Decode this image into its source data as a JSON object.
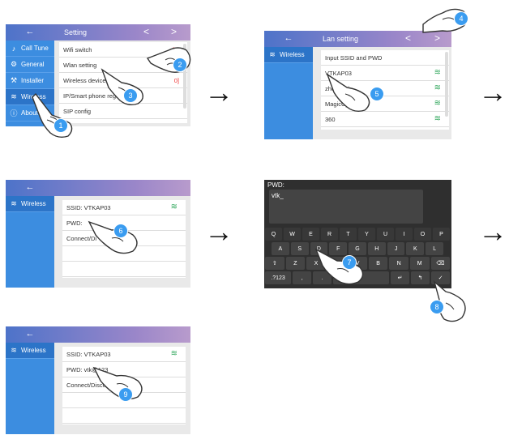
{
  "step1": {
    "header_back": "←",
    "header_title": "Setting",
    "header_prev": "<",
    "header_next": ">",
    "sidebar": [
      "Call Tune",
      "General",
      "Installer",
      "Wireless",
      "About"
    ],
    "rows": [
      {
        "label": "Wifi switch",
        "value": "[O"
      },
      {
        "label": "Wlan setting",
        "value": ""
      },
      {
        "label": "Wireless devices",
        "value": "0]"
      },
      {
        "label": "IP/Smart phone regi",
        "value": ""
      },
      {
        "label": "SIP config",
        "value": ""
      }
    ]
  },
  "step2": {
    "header_back": "←",
    "header_title": "Lan setting",
    "header_prev": "<",
    "header_next": ">",
    "sidebar": [
      "Wireless"
    ],
    "rows": [
      "Input SSID and PWD",
      "VTKAP03",
      "zhongshi",
      "MagicCyclingG",
      "360"
    ]
  },
  "step3": {
    "header_back": "←",
    "sidebar": [
      "Wireless"
    ],
    "rows": [
      "SSID: VTKAP03",
      "PWD:",
      "Connect/Di"
    ]
  },
  "step4": {
    "pwd_label": "PWD:",
    "pwd_value": "vtk_",
    "row1": [
      "Q",
      "W",
      "E",
      "R",
      "T",
      "Y",
      "U",
      "I",
      "O",
      "P"
    ],
    "row2": [
      "A",
      "S",
      "D",
      "F",
      "G",
      "H",
      "J",
      "K",
      "L"
    ],
    "row3": [
      "⇧",
      "Z",
      "X",
      "C",
      "V",
      "B",
      "N",
      "M",
      "⌫"
    ],
    "row4": [
      ".?123",
      ",",
      ".",
      "",
      "↵",
      "↰",
      "✓"
    ]
  },
  "step5": {
    "header_back": "←",
    "sidebar": [
      "Wireless"
    ],
    "rows": [
      "SSID: VTKAP03",
      "PWD: vtk@123",
      "Connect/Disconnect"
    ]
  },
  "badges": [
    "1",
    "2",
    "3",
    "4",
    "5",
    "6",
    "7",
    "8",
    "9"
  ],
  "arrows": [
    "→",
    "→",
    "→",
    "→"
  ],
  "icons": {
    "wifi": "wifi-icon",
    "music": "music-note-icon",
    "gear": "gear-icon",
    "wrench": "wrench-icon",
    "info": "info-icon"
  }
}
